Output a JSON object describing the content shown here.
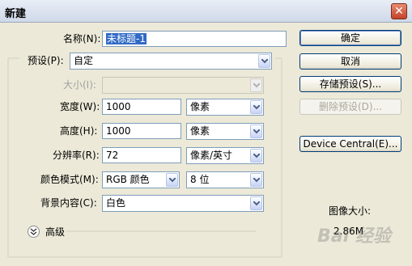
{
  "window": {
    "title": "新建",
    "close_glyph": "✕"
  },
  "name": {
    "label": "名称(N):",
    "value_selected": "未标题-1"
  },
  "preset": {
    "label": "预设(P):",
    "value": "自定"
  },
  "size": {
    "label": "大小(I):",
    "value": ""
  },
  "width": {
    "label": "宽度(W):",
    "value": "1000",
    "unit": "像素"
  },
  "height": {
    "label": "高度(H):",
    "value": "1000",
    "unit": "像素"
  },
  "resolution": {
    "label": "分辨率(R):",
    "value": "72",
    "unit": "像素/英寸"
  },
  "color_mode": {
    "label": "颜色模式(M):",
    "value": "RGB 颜色",
    "depth": "8 位"
  },
  "background": {
    "label": "背景内容(C):",
    "value": "白色"
  },
  "advanced": {
    "label": "高级",
    "icon": "chevron-double-down-icon"
  },
  "buttons": {
    "ok": "确定",
    "cancel": "取消",
    "save_preset": "存储预设(S)...",
    "delete_preset": "删除预设(D)...",
    "device_central": "Device Central(E)..."
  },
  "image_size": {
    "label": "图像大小:",
    "value": "2.86M"
  },
  "watermark": "Bai 经验"
}
